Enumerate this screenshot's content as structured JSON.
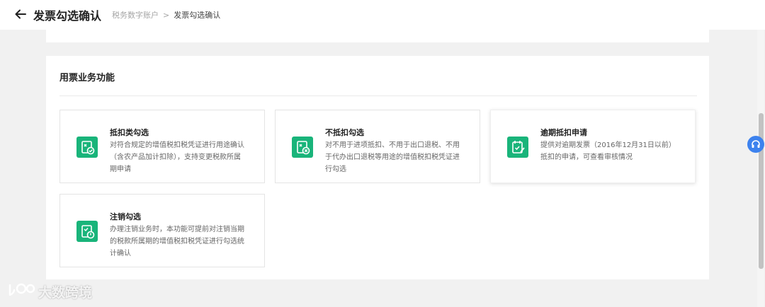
{
  "header": {
    "title": "发票勾选确认",
    "breadcrumb": [
      "税务数字账户",
      "发票勾选确认"
    ],
    "breadcrumb_separator": ">"
  },
  "section": {
    "title": "用票业务功能",
    "tiles": [
      {
        "title": "抵扣类勾选",
        "desc": "对符合规定的增值税扣税凭证进行用途确认\n（含农产品加计扣除），支持变更税款所属\n期申请",
        "icon": "deduction-select-icon"
      },
      {
        "title": "不抵扣勾选",
        "desc": "对不用于进项抵扣、不用于出口退税、不用\n于代办出口退税等用途的增值税扣税凭证进\n行勾选",
        "icon": "non-deduction-select-icon"
      },
      {
        "title": "逾期抵扣申请",
        "desc": "提供对逾期发票（2016年12月31日以前）\n抵扣的申请，可查看审核情况",
        "icon": "overdue-deduction-icon"
      },
      {
        "title": "注销勾选",
        "desc": "办理注销业务时，本功能可提前对注销当期\n的税款所属期的增值税扣税凭证进行勾选统\n计确认",
        "icon": "cancellation-select-icon"
      }
    ]
  },
  "watermark": {
    "text": "大数跨境"
  },
  "colors": {
    "accent": "#19b47a",
    "support": "#3d82ee",
    "background": "#f1f1f1"
  }
}
